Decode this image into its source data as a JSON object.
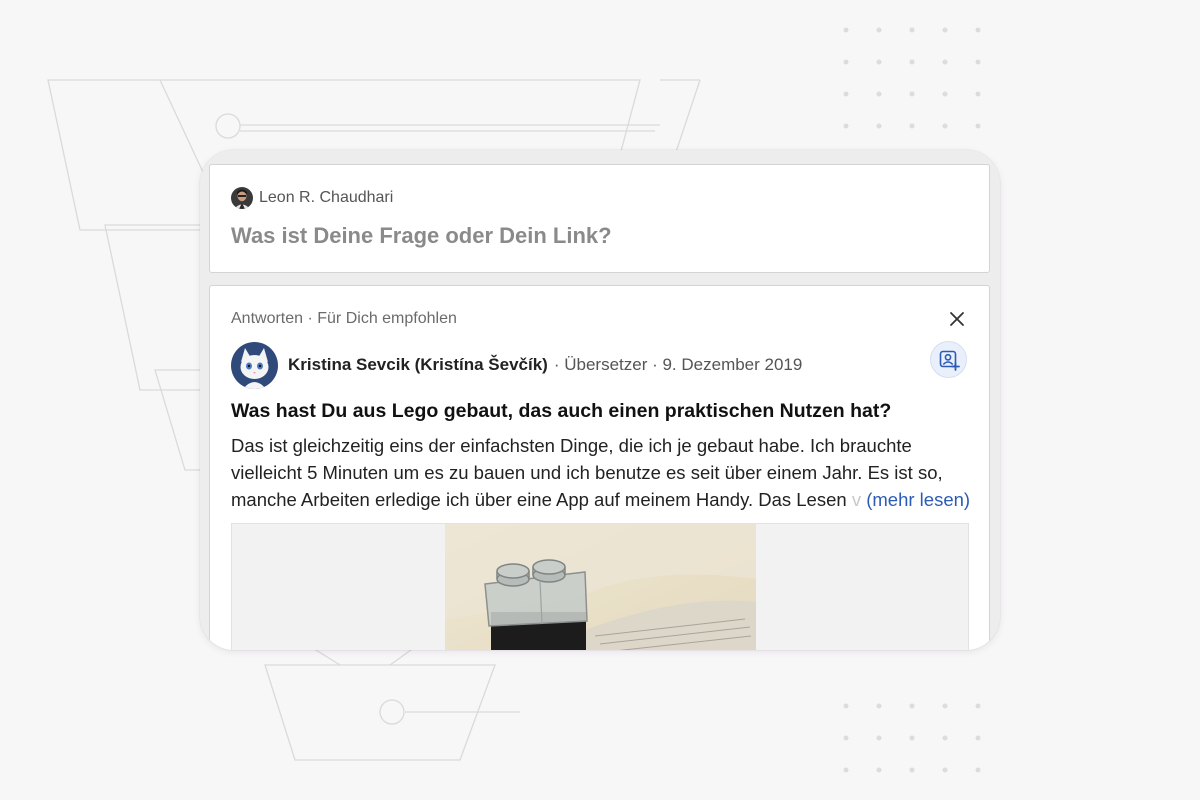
{
  "composer": {
    "user_name": "Leon R. Chaudhari",
    "prompt": "Was ist Deine Frage oder Dein Link?"
  },
  "answer_card": {
    "meta": "Antworten · Für Dich empfohlen",
    "author": {
      "name": "Kristina Sevcik (Kristína Ševčík)",
      "meta": "· Übersetzer · 9. Dezember 2019"
    },
    "question": "Was hast Du aus Lego gebaut, das auch einen praktischen Nutzen hat?",
    "answer_lines": [
      "Das ist gleichzeitig eins der einfachsten Dinge, die ich je gebaut habe. Ich brauchte",
      "vielleicht 5 Minuten um es zu bauen und ich benutze es seit über einem Jahr. Es ist so,",
      "manche Arbeiten erledige ich über eine App auf meinem Handy. Das Lesen"
    ],
    "answer_fade": "v",
    "more_label": "(mehr lesen)"
  },
  "icons": {
    "close": "close-icon",
    "follow": "add-person-icon",
    "cursor": "mouse-cursor-icon"
  },
  "colors": {
    "link": "#2b5bb5",
    "prompt": "#8a8a8a",
    "follow_bg": "#eaf0fb"
  }
}
